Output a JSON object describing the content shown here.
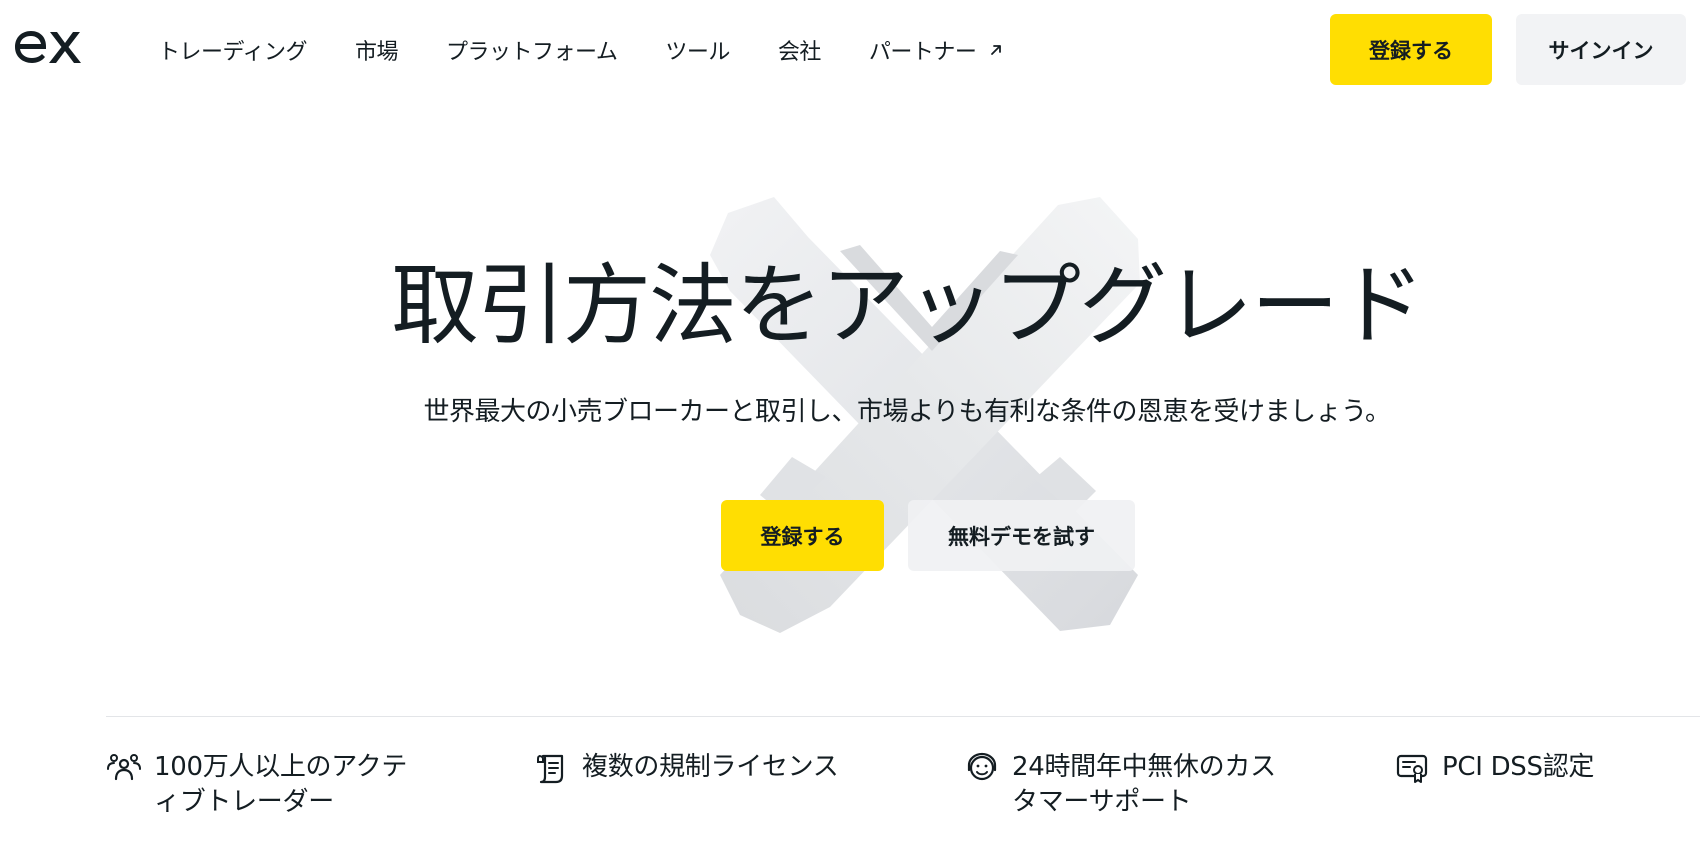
{
  "header": {
    "logo_text": "ex",
    "nav": [
      {
        "label": "トレーディング"
      },
      {
        "label": "市場"
      },
      {
        "label": "プラットフォーム"
      },
      {
        "label": "ツール"
      },
      {
        "label": "会社"
      },
      {
        "label": "パートナー",
        "icon": "external-link-icon"
      }
    ],
    "register_label": "登録する",
    "signin_label": "サインイン"
  },
  "hero": {
    "title": "取引方法をアップグレード",
    "subtitle": "世界最大の小売ブローカーと取引し、市場よりも有利な条件の恩恵を受けましょう。",
    "register_label": "登録する",
    "demo_label": "無料デモを試す"
  },
  "features": [
    {
      "icon": "users-icon",
      "text": "100万人以上のアクティブトレーダー"
    },
    {
      "icon": "document-icon",
      "text": "複数の規制ライセンス"
    },
    {
      "icon": "support-icon",
      "text": "24時間年中無休のカスタマーサポート"
    },
    {
      "icon": "certificate-icon",
      "text": "PCI DSS認定"
    }
  ],
  "colors": {
    "accent": "#ffde02",
    "text": "#141d22",
    "secondary_button": "#f2f3f5",
    "divider": "#e3e5e8"
  }
}
